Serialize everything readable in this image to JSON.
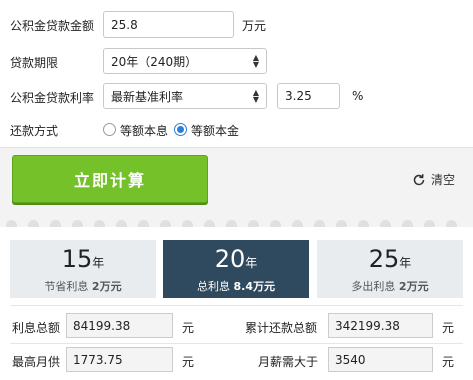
{
  "form": {
    "loan_amount": {
      "label": "公积金贷款金额",
      "value": "25.8",
      "unit": "万元"
    },
    "loan_term": {
      "label": "贷款期限",
      "selected": "20年（240期）"
    },
    "rate": {
      "label": "公积金贷款利率",
      "selected": "最新基准利率",
      "value": "3.25",
      "unit": "%"
    },
    "repay": {
      "label": "还款方式",
      "options": [
        "等额本息",
        "等额本金"
      ],
      "selected_index": 1
    }
  },
  "actions": {
    "calculate": "立即计算",
    "clear": "清空"
  },
  "tabs": [
    {
      "year": "15",
      "unit": "年",
      "sub_prefix": "节省利息",
      "sub_value": "2万元",
      "active": false
    },
    {
      "year": "20",
      "unit": "年",
      "sub_prefix": "总利息",
      "sub_value": "8.4万元",
      "active": true
    },
    {
      "year": "25",
      "unit": "年",
      "sub_prefix": "多出利息",
      "sub_value": "2万元",
      "active": false
    }
  ],
  "results": {
    "total_interest": {
      "label": "利息总额",
      "value": "84199.38",
      "unit": "元"
    },
    "total_repay": {
      "label": "累计还款总额",
      "value": "342199.38",
      "unit": "元"
    },
    "max_monthly": {
      "label": "最高月供",
      "value": "1773.75",
      "unit": "元"
    },
    "salary_needed": {
      "label": "月薪需大于",
      "value": "3540",
      "unit": "元"
    }
  },
  "colors": {
    "accent_green": "#74c12a",
    "tab_active": "#2f4a5e",
    "radio_blue": "#2a7fd6"
  },
  "icons": {
    "clear": "refresh-icon",
    "select": "up-down-arrows-icon"
  }
}
